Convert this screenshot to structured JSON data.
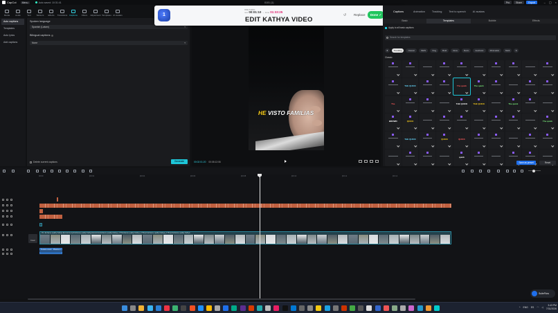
{
  "titlebar": {
    "app": "CapCut",
    "menu": "Menu",
    "project": "Auto saved: 10:31:41",
    "center": "0101 (1)",
    "pro": "Pro",
    "share": "Share",
    "export": "Export"
  },
  "toolbar": [
    {
      "label": "Media",
      "icon": "media-icon"
    },
    {
      "label": "Audio",
      "icon": "audio-icon"
    },
    {
      "label": "Text",
      "icon": "text-icon"
    },
    {
      "label": "Stickers",
      "icon": "stickers-icon"
    },
    {
      "label": "Effects",
      "icon": "effects-icon"
    },
    {
      "label": "Transitions",
      "icon": "transitions-icon"
    },
    {
      "label": "Captions",
      "icon": "captions-icon",
      "active": true
    },
    {
      "label": "Filters",
      "icon": "filters-icon"
    },
    {
      "label": "Adjustment",
      "icon": "adjustment-icon"
    },
    {
      "label": "Templates",
      "icon": "templates-icon"
    },
    {
      "label": "AI avatars",
      "icon": "ai-avatars-icon"
    }
  ],
  "leftnav": [
    "Auto captions",
    "Templates",
    "Auto lyrics",
    "Add captions"
  ],
  "captions": {
    "spoken_label": "Spoken language",
    "spoken_value": "Spanish (Latam)",
    "bilingual_label": "Bilingual captions",
    "bilingual_value": "None",
    "delete_label": "Delete current captions",
    "generate": "Generate"
  },
  "overlay": {
    "badge": "1",
    "timer_label": "ONE THING",
    "elapsed_prefix": "now",
    "elapsed": "00:01:10",
    "sep": "→",
    "target_prefix": "done",
    "target": "01:33:25",
    "headline": "EDIT KATHYA VIDEO",
    "replace": "Replace",
    "done": "Done ✓",
    "close": "×",
    "undo": "↺"
  },
  "preview": {
    "caption_highlight": "HE",
    "caption_rest": "VISTO FAMILIAS",
    "current_time": "00:02:01:20",
    "total_time": "00:08:12:06"
  },
  "rpanel": {
    "tabs": [
      "Captions",
      "Animation",
      "Tracking",
      "Text to speech",
      "AI avatars"
    ],
    "subtabs": [
      "Basic",
      "Templates",
      "Bubble",
      "Effects"
    ],
    "apply_all": "Apply to all basic captions",
    "search_placeholder": "Search for templates",
    "chips": [
      "Trending",
      "Classic",
      "NEW",
      "Vlog",
      "Bold",
      "Glow",
      "Retro",
      "Aesthetic",
      "Minimalist",
      "Multi"
    ],
    "section": "Classic",
    "templates": [
      "",
      "",
      "",
      "",
      "",
      "",
      "",
      "",
      "",
      "",
      "",
      "THE QUICK",
      "",
      "",
      "The quick",
      "The quick",
      "",
      "",
      "",
      "",
      "The",
      "",
      "",
      "",
      "THE QUICK",
      "THE QUICK",
      "",
      "The quick",
      "",
      "",
      "BROWN",
      "QUICK",
      "",
      "",
      "",
      "",
      "",
      "",
      "",
      "The quick",
      "",
      "THE QUICK",
      "",
      "QUICK",
      "QUICK",
      "",
      "",
      "",
      "",
      "",
      "",
      "",
      "",
      "",
      "quick",
      "",
      "",
      "",
      "",
      ""
    ],
    "save_preset": "Save as preset",
    "reset": "Reset"
  },
  "timeline": {
    "ticks": [
      "00:00",
      "|00:02",
      "|00:04",
      "|00:06",
      "|00:08",
      "|00:10",
      "|00:12",
      "|00:14"
    ],
    "video_label": "Pro: Enhance quality  Kathya Economía.mp4   Enhance quality  Kathya Economía  Enhance quality  Kathya_3.75  Enhance quality  Kathya_0.75mp4  Enhance quality  Kathya_0.75mp4  Enhance quality  Kathya",
    "cover": "Cover",
    "audio1": "Texture cover",
    "audio2": "Plasma 1"
  },
  "fab": "SuiteFlow",
  "taskbar": {
    "lang": "ENG",
    "lang2": "ES",
    "time": "3:43 PM",
    "date": "7/31/2026"
  },
  "colors": {
    "accent": "#1ec6d8",
    "highlight": "#ffd21a",
    "orange_clip": "#c06040",
    "done_green": "#22c55e"
  }
}
